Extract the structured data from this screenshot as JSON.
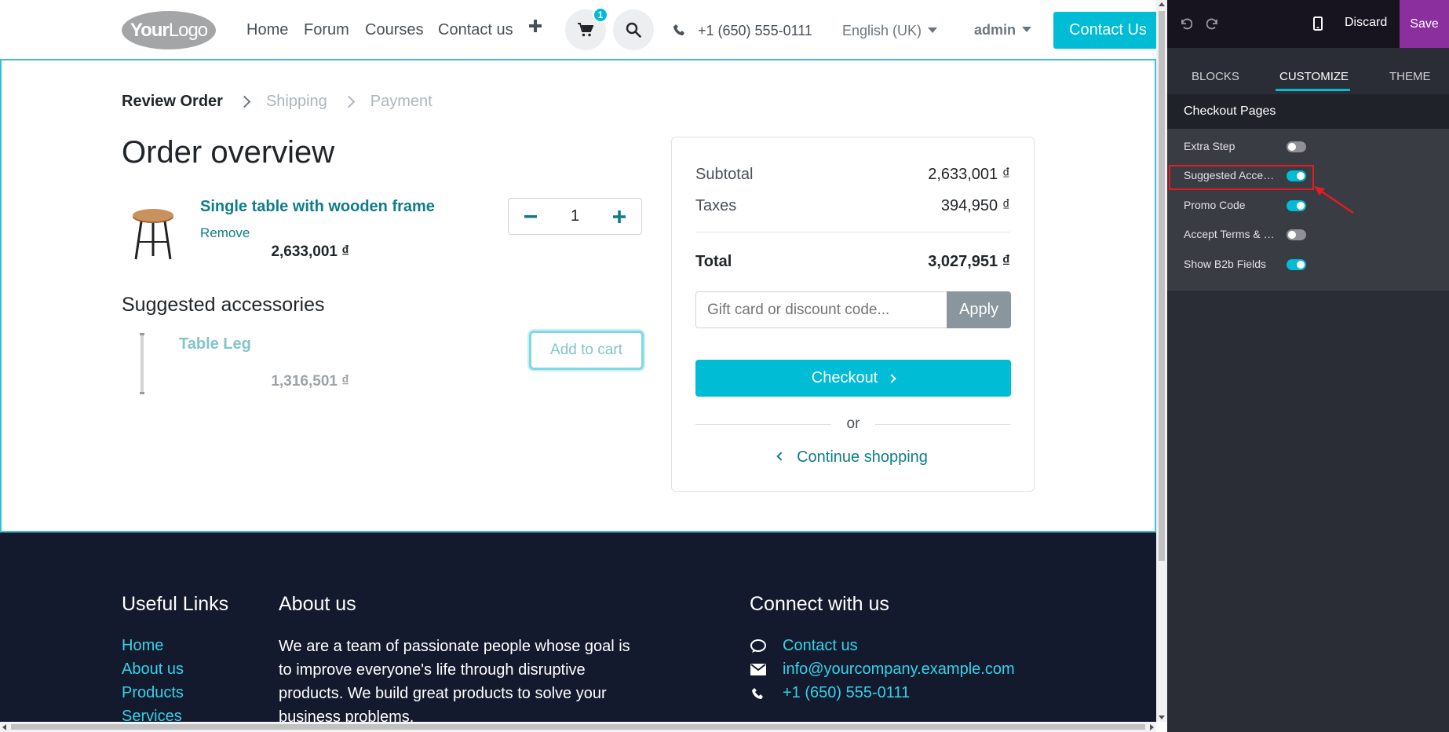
{
  "nav": {
    "logo_text_bold": "Your",
    "logo_text_light": "Logo",
    "links": [
      "Home",
      "Forum",
      "Courses",
      "Contact us"
    ],
    "cart_count": "1",
    "phone": "+1 (650) 555-0111",
    "language": "English (UK)",
    "user": "admin",
    "cta": "Contact Us"
  },
  "checkout_steps": {
    "step1": "Review Order",
    "step2": "Shipping",
    "step3": "Payment"
  },
  "order": {
    "title": "Order overview",
    "product_name": "Single table with wooden frame",
    "remove_label": "Remove",
    "quantity": "1",
    "product_price": "2,633,001 ₫"
  },
  "suggested": {
    "title": "Suggested accessories",
    "item_name": "Table Leg",
    "add_label": "Add to cart",
    "item_price": "1,316,501 ₫"
  },
  "summary": {
    "subtotal_label": "Subtotal",
    "subtotal_value": "2,633,001 ₫",
    "taxes_label": "Taxes",
    "taxes_value": "394,950 ₫",
    "total_label": "Total",
    "total_value": "3,027,951 ₫",
    "promo_placeholder": "Gift card or discount code...",
    "apply_label": "Apply",
    "checkout_label": "Checkout",
    "or_label": "or",
    "continue_label": "Continue shopping"
  },
  "footer": {
    "links_title": "Useful Links",
    "links": [
      "Home",
      "About us",
      "Products",
      "Services"
    ],
    "about_title": "About us",
    "about_text": "We are a team of passionate people whose goal is to improve everyone's life through disruptive products. We build great products to solve your business problems.",
    "connect_title": "Connect with us",
    "contact_link": "Contact us",
    "email": "info@yourcompany.example.com",
    "phone": "+1 (650) 555-0111"
  },
  "editor": {
    "discard_label": "Discard",
    "save_label": "Save",
    "tabs": [
      "BLOCKS",
      "CUSTOMIZE",
      "THEME"
    ],
    "active_tab": "CUSTOMIZE",
    "section_title": "Checkout Pages",
    "options": [
      {
        "label": "Extra Step",
        "enabled": false
      },
      {
        "label": "Suggested Accessories",
        "enabled": true
      },
      {
        "label": "Promo Code",
        "enabled": true
      },
      {
        "label": "Accept Terms & Conditions",
        "enabled": false
      },
      {
        "label": "Show B2b Fields",
        "enabled": true
      }
    ]
  },
  "colors": {
    "accent": "#00bcd4",
    "link": "#0f7c8b",
    "footer_bg": "#141a2e",
    "save": "#8b2f9e",
    "highlight": "#e31b23"
  }
}
